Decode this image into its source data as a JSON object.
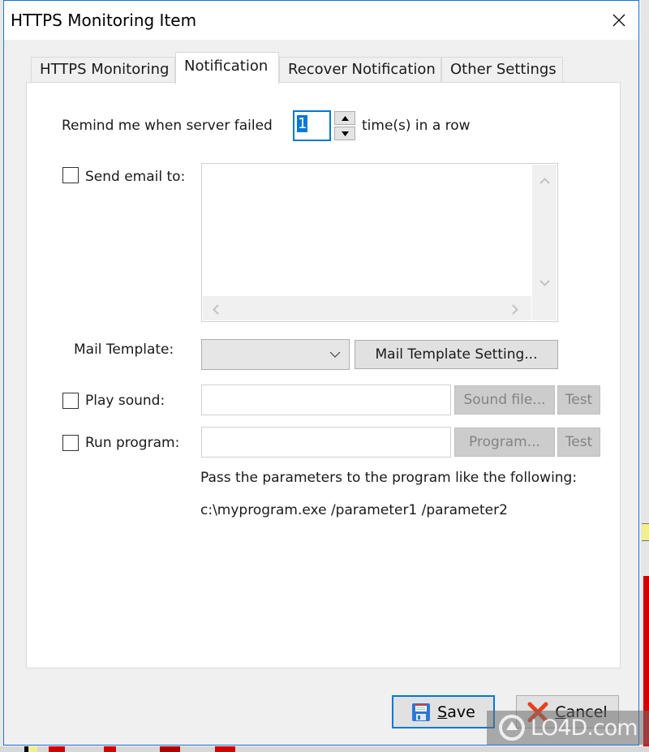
{
  "window": {
    "title": "HTTPS Monitoring Item",
    "close_icon": "close-icon"
  },
  "tabs": [
    {
      "label": "HTTPS Monitoring",
      "active": false
    },
    {
      "label": "Notification",
      "active": true
    },
    {
      "label": "Recover Notification",
      "active": false
    },
    {
      "label": "Other Settings",
      "active": false
    }
  ],
  "notification": {
    "remind_prefix": "Remind me when server failed",
    "remind_value": "1",
    "remind_suffix": "time(s) in a row",
    "send_email": {
      "label": "Send email to:",
      "checked": false,
      "value": ""
    },
    "mail_template": {
      "label": "Mail Template:",
      "selected": "",
      "setting_button": "Mail Template Setting..."
    },
    "play_sound": {
      "label": "Play sound:",
      "checked": false,
      "value": "",
      "browse_button": "Sound file...",
      "test_button": "Test"
    },
    "run_program": {
      "label": "Run program:",
      "checked": false,
      "value": "",
      "browse_button": "Program...",
      "test_button": "Test"
    },
    "hint_line1": "Pass the parameters to the program like the following:",
    "hint_line2": "c:\\myprogram.exe /parameter1 /parameter2"
  },
  "footer": {
    "save_label": "Save",
    "save_accel": "S",
    "save_rest": "ave",
    "cancel_label": "Cancel",
    "cancel_accel": "C",
    "cancel_rest": "ancel",
    "save_icon": "floppy-disk-icon",
    "cancel_icon": "red-x-icon"
  },
  "watermark": {
    "text": "LO4D.com"
  },
  "colors": {
    "accent": "#0078d7",
    "window_border": "#1a73d6",
    "dialog_bg": "#f0f0f0",
    "panel_bg": "#ffffff",
    "cancel_red": "#e8401c"
  }
}
